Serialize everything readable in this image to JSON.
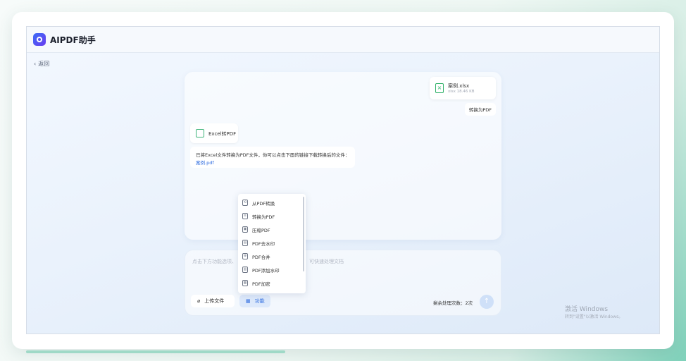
{
  "app": {
    "title": "AIPDF助手"
  },
  "nav": {
    "back_label": "返回"
  },
  "chat": {
    "file": {
      "name": "案例.xlsx",
      "meta": "xlsx 18.46 KB"
    },
    "user_message": "转换为PDF",
    "tool": {
      "name": "Excel转PDF"
    },
    "reply": {
      "text": "已将Excel文件转换为PDF文件，你可以点击下面的链接下载转换后的文件：",
      "link": "案例.pdf"
    }
  },
  "input": {
    "placeholder_left": "点击下方功能选项、",
    "placeholder_right": "可快速处理文档",
    "upload_label": "上传文件",
    "function_label": "功能",
    "remaining_label": "剩余处理次数：2次"
  },
  "menu": {
    "items": [
      {
        "label": "从PDF转换",
        "icon": "convert-from-icon"
      },
      {
        "label": "转换为PDF",
        "icon": "convert-to-icon"
      },
      {
        "label": "压缩PDF",
        "icon": "compress-icon"
      },
      {
        "label": "PDF去水印",
        "icon": "remove-watermark-icon"
      },
      {
        "label": "PDF合并",
        "icon": "merge-icon"
      },
      {
        "label": "PDF添加水印",
        "icon": "add-watermark-icon"
      },
      {
        "label": "PDF加密",
        "icon": "encrypt-icon"
      }
    ]
  },
  "os_watermark": {
    "line1": "激活 Windows",
    "line2": "转到\"设置\"以激活 Windows。"
  },
  "colors": {
    "accent": "#2f6de0",
    "excel_green": "#33b36b"
  }
}
